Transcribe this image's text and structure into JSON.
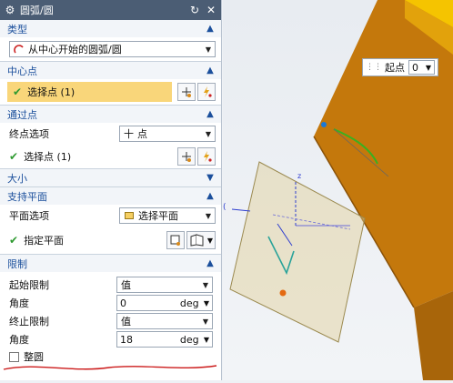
{
  "window": {
    "title": "圆弧/圆"
  },
  "sections": {
    "type": {
      "label": "类型",
      "dropdown_value": "从中心开始的圆弧/圆"
    },
    "center": {
      "label": "中心点",
      "select_label": "选择点 (1)"
    },
    "through": {
      "label": "通过点",
      "option_label": "终点选项",
      "option_value": "点",
      "select_label": "选择点 (1)"
    },
    "size": {
      "label": "大小"
    },
    "plane": {
      "label": "支持平面",
      "option_label": "平面选项",
      "option_value": "选择平面",
      "select_label": "指定平面"
    },
    "limits": {
      "label": "限制",
      "start_label": "起始限制",
      "start_value": "值",
      "angle1_label": "角度",
      "angle1_value": "0",
      "end_label": "终止限制",
      "end_value": "值",
      "angle2_label": "角度",
      "angle2_value": "18",
      "unit": "deg",
      "full_circle_label": "整圆"
    }
  },
  "popup": {
    "label": "起点",
    "value": "0"
  },
  "colors": {
    "titlebar": "#4b5d74",
    "section_text": "#1b4f9c",
    "selected": "#f9d67a",
    "solid": "#c4780c",
    "annotation": "#cc1b1b"
  }
}
